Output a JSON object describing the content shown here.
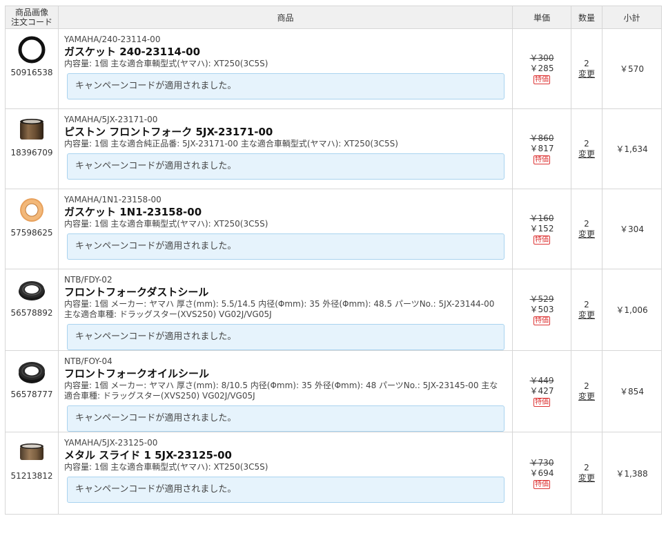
{
  "header": {
    "code_col_line1": "商品画像",
    "code_col_line2": "注文コード",
    "product_col": "商品",
    "unit_price_col": "単価",
    "qty_col": "数量",
    "subtotal_col": "小計"
  },
  "items": [
    {
      "image": "o-ring-gasket-black",
      "order_code": "50916538",
      "maker_code": "YAMAHA/240-23114-00",
      "name": "ガスケット 240-23114-00",
      "spec": "内容量: 1個  主な適合車輌型式(ヤマハ): XT250(3C5S)",
      "campaign": "キャンペーンコードが適用されました。",
      "price_old": "￥300",
      "price_new": "￥285",
      "badge": "特価",
      "qty": "2",
      "change": "変更",
      "subtotal": "￥570"
    },
    {
      "image": "piston-bushing-brown",
      "order_code": "18396709",
      "maker_code": "YAMAHA/5JX-23171-00",
      "name": "ピストン フロントフォーク 5JX-23171-00",
      "spec": "内容量: 1個  主な適合純正品番: 5JX-23171-00  主な適合車輌型式(ヤマハ): XT250(3C5S)",
      "campaign": "キャンペーンコードが適用されました。",
      "price_old": "￥860",
      "price_new": "￥817",
      "badge": "特価",
      "qty": "2",
      "change": "変更",
      "subtotal": "￥1,634"
    },
    {
      "image": "copper-washer-gasket",
      "order_code": "57598625",
      "maker_code": "YAMAHA/1N1-23158-00",
      "name": "ガスケット 1N1-23158-00",
      "spec": "内容量: 1個  主な適合車輌型式(ヤマハ): XT250(3C5S)",
      "campaign": "キャンペーンコードが適用されました。",
      "price_old": "￥160",
      "price_new": "￥152",
      "badge": "特価",
      "qty": "2",
      "change": "変更",
      "subtotal": "￥304"
    },
    {
      "image": "dust-seal-black",
      "order_code": "56578892",
      "maker_code": "NTB/FDY-02",
      "name": "フロントフォークダストシール",
      "spec": "内容量: 1個  メーカー: ヤマハ  厚さ(mm): 5.5/14.5  内径(Φmm): 35  外径(Φmm): 48.5  パーツNo.: 5JX-23144-00  主な適合車種: ドラッグスター(XVS250) VG02J/VG05J",
      "campaign": "キャンペーンコードが適用されました。",
      "price_old": "￥529",
      "price_new": "￥503",
      "badge": "特価",
      "qty": "2",
      "change": "変更",
      "subtotal": "￥1,006"
    },
    {
      "image": "oil-seal-black",
      "order_code": "56578777",
      "maker_code": "NTB/FOY-04",
      "name": "フロントフォークオイルシール",
      "spec": "内容量: 1個  メーカー: ヤマハ  厚さ(mm): 8/10.5  内径(Φmm): 35  外径(Φmm): 48  パーツNo.: 5JX-23145-00  主な適合車種: ドラッグスター(XVS250) VG02J/VG05J",
      "campaign": "キャンペーンコードが適用されました。",
      "price_old": "￥449",
      "price_new": "￥427",
      "badge": "特価",
      "qty": "2",
      "change": "変更",
      "subtotal": "￥854"
    },
    {
      "image": "metal-slide-bushing",
      "order_code": "51213812",
      "maker_code": "YAMAHA/5JX-23125-00",
      "name": "メタル スライド 1 5JX-23125-00",
      "spec": "内容量: 1個  主な適合車輌型式(ヤマハ): XT250(3C5S)",
      "campaign": "キャンペーンコードが適用されました。",
      "price_old": "￥730",
      "price_new": "￥694",
      "badge": "特価",
      "qty": "2",
      "change": "変更",
      "subtotal": "￥1,388"
    }
  ]
}
